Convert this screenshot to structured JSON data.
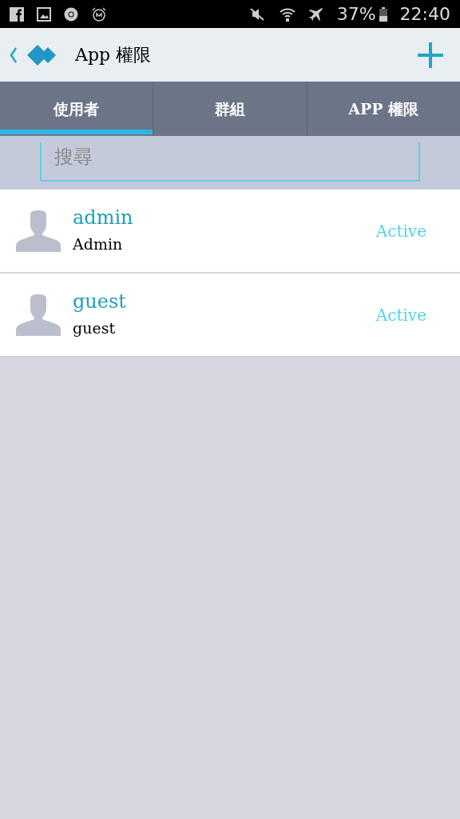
{
  "status_bar": {
    "battery": "37%",
    "time": "22:40"
  },
  "header": {
    "title": "App 權限"
  },
  "tabs": [
    {
      "label": "使用者",
      "selected": true
    },
    {
      "label": "群組",
      "selected": false
    },
    {
      "label": "APP 權限",
      "selected": false
    }
  ],
  "search": {
    "placeholder": "搜尋"
  },
  "users": [
    {
      "name": "admin",
      "role": "Admin",
      "status": "Active"
    },
    {
      "name": "guest",
      "role": "guest",
      "status": "Active"
    }
  ]
}
